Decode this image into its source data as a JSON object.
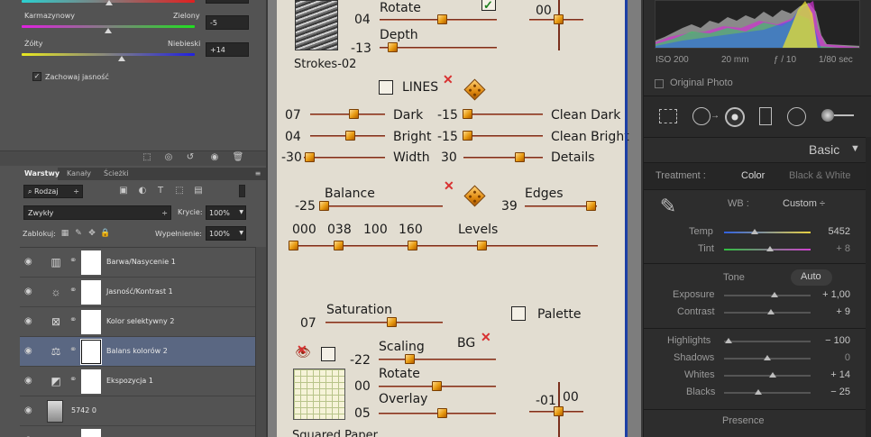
{
  "photoshop": {
    "sliders": {
      "magenta_label": "Karmazynowy",
      "green_label": "Zielony",
      "magenta_value": "-5",
      "yellow_label": "Żółty",
      "blue_label": "Niebieski",
      "yellow_value": "+14",
      "preserve_label": "Zachowaj jasność"
    },
    "tabs": [
      "Warstwy",
      "Kanały",
      "Ścieżki"
    ],
    "kind_label": "Rodzaj",
    "blend_mode": "Zwykły",
    "opacity_label": "Krycie:",
    "opacity_value": "100%",
    "lock_label": "Zablokuj:",
    "fill_label": "Wypełnienie:",
    "fill_value": "100%",
    "layers": [
      {
        "name": "Barwa/Nasycenie 1",
        "icon": "hue-saturation-icon"
      },
      {
        "name": "Jasność/Kontrast 1",
        "icon": "brightness-contrast-icon"
      },
      {
        "name": "Kolor selektywny 2",
        "icon": "selective-color-icon"
      },
      {
        "name": "Balans kolorów 2",
        "icon": "color-balance-icon"
      },
      {
        "name": "Ekspozycja 1",
        "icon": "exposure-icon"
      },
      {
        "name": "5742 0",
        "icon": "image-thumb"
      }
    ]
  },
  "filter": {
    "preset_name": "Strokes-02",
    "rotate_label": "Rotate",
    "rotate_value": "04",
    "depth_label": "Depth",
    "depth_value": "-13",
    "top_right_value": "00",
    "lines_label": "LINES",
    "rows": [
      {
        "left_val": "07",
        "left_label": "Dark",
        "right_val": "-15",
        "right_label": "Clean Dark"
      },
      {
        "left_val": "04",
        "left_label": "Bright",
        "right_val": "-15",
        "right_label": "Clean Bright"
      },
      {
        "left_val": "-30",
        "left_label": "Width",
        "right_val": "30",
        "right_label": "Details"
      }
    ],
    "balance_label": "Balance",
    "balance_value": "-25",
    "edges_label": "Edges",
    "edges_value": "39",
    "levels": [
      "000",
      "038",
      "100",
      "160"
    ],
    "levels_label": "Levels",
    "saturation_label": "Saturation",
    "saturation_value": "07",
    "palette_label": "Palette",
    "scaling_label": "Scaling",
    "scaling_value": "-22",
    "bg_label": "BG",
    "rotate2_label": "Rotate",
    "rotate2_value": "00",
    "overlay_label": "Overlay",
    "overlay_value": "05",
    "bottom_right_left": "-01",
    "bottom_right_top": "00",
    "paper_name": "Squared Paper"
  },
  "lightroom": {
    "exif": [
      "ISO 200",
      "20 mm",
      "ƒ / 10",
      "1/80 sec"
    ],
    "original_photo": "Original Photo",
    "panel_title": "Basic",
    "treatment_label": "Treatment :",
    "treatment_color": "Color",
    "treatment_bw": "Black & White",
    "wb_label": "WB :",
    "wb_value": "Custom ÷",
    "temp_label": "Temp",
    "temp_value": "5452",
    "tint_label": "Tint",
    "tint_value": "+ 8",
    "tone_label": "Tone",
    "auto_label": "Auto",
    "exposure_label": "Exposure",
    "exposure_value": "+ 1,00",
    "contrast_label": "Contrast",
    "contrast_value": "+ 9",
    "highlights_label": "Highlights",
    "highlights_value": "− 100",
    "shadows_label": "Shadows",
    "shadows_value": "0",
    "whites_label": "Whites",
    "whites_value": "+ 14",
    "blacks_label": "Blacks",
    "blacks_value": "− 25",
    "presence_label": "Presence"
  }
}
